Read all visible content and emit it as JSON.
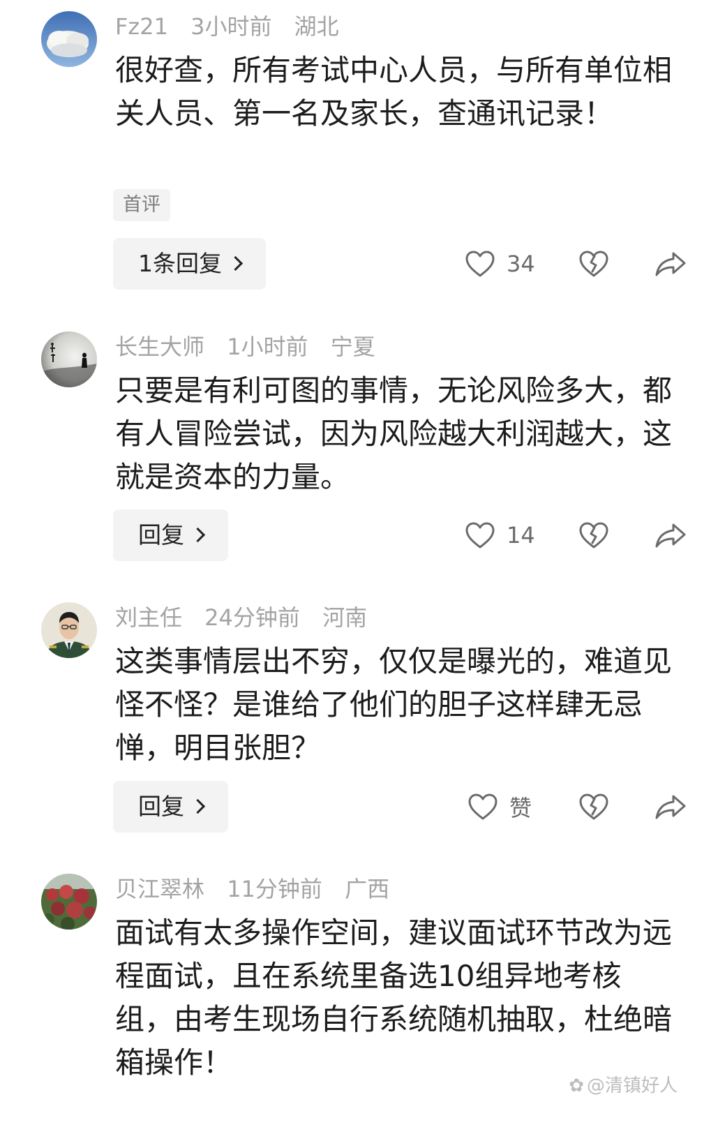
{
  "comments": [
    {
      "user": "Fz21",
      "time": "3小时前",
      "location": "湖北",
      "text": "很好查，所有考试中心人员，与所有单位相关人员、第一名及家长，查通讯记录！",
      "tag": "首评",
      "reply_label": "1条回复",
      "likes": "34"
    },
    {
      "user": "长生大师",
      "time": "1小时前",
      "location": "宁夏",
      "text": "只要是有利可图的事情，无论风险多大，都有人冒险尝试，因为风险越大利润越大，这就是资本的力量。",
      "reply_label": "回复",
      "likes": "14"
    },
    {
      "user": "刘主任",
      "time": "24分钟前",
      "location": "河南",
      "text": "这类事情层出不穷，仅仅是曝光的，难道见怪不怪？是谁给了他们的胆子这样肆无忌惮，明目张胆？",
      "reply_label": "回复",
      "likes": "赞"
    },
    {
      "user": "贝江翠林",
      "time": "11分钟前",
      "location": "广西",
      "text": "面试有太多操作空间，建议面试环节改为远程面试，且在系统里备选10组异地考核组，由考生现场自行系统随机抽取，杜绝暗箱操作！"
    }
  ],
  "watermark": "@清镇好人",
  "icons": {
    "like": "heart-outline-icon",
    "dislike": "broken-heart-icon",
    "share": "share-arrow-icon",
    "reply_arrow": "chevron-right-icon"
  },
  "colors": {
    "meta": "#a3a3a3",
    "text": "#1c1c1c",
    "pill_bg": "#f3f3f3",
    "icon": "#6a6a6a"
  }
}
